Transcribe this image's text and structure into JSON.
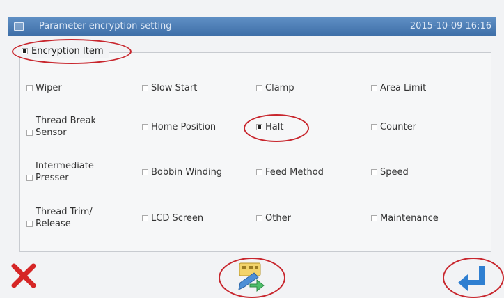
{
  "window": {
    "title": "Parameter encryption setting",
    "datetime": "2015-10-09 16:16"
  },
  "encryption_item": {
    "label": "Encryption Item",
    "checked": true
  },
  "items": [
    {
      "label": "Wiper",
      "checked": false
    },
    {
      "label": "Slow Start",
      "checked": false
    },
    {
      "label": "Clamp",
      "checked": false
    },
    {
      "label": "Area Limit",
      "checked": false
    },
    {
      "label": "Thread Break\nSensor",
      "checked": false
    },
    {
      "label": "Home Position",
      "checked": false
    },
    {
      "label": "Halt",
      "checked": true
    },
    {
      "label": "Counter",
      "checked": false
    },
    {
      "label": "Intermediate\nPresser",
      "checked": false
    },
    {
      "label": "Bobbin Winding",
      "checked": false
    },
    {
      "label": "Feed Method",
      "checked": false
    },
    {
      "label": "Speed",
      "checked": false
    },
    {
      "label": "Thread Trim/\nRelease",
      "checked": false
    },
    {
      "label": "LCD Screen",
      "checked": false
    },
    {
      "label": "Other",
      "checked": false
    },
    {
      "label": "Maintenance",
      "checked": false
    }
  ],
  "buttons": {
    "cancel_icon": "close-icon",
    "encrypt_icon": "edit-icon",
    "enter_icon": "enter-icon"
  },
  "colors": {
    "title_bar": "#4a7bb5",
    "highlight_ring": "#c8262d",
    "cancel_red": "#d62626",
    "enter_blue": "#2f7fd1"
  }
}
